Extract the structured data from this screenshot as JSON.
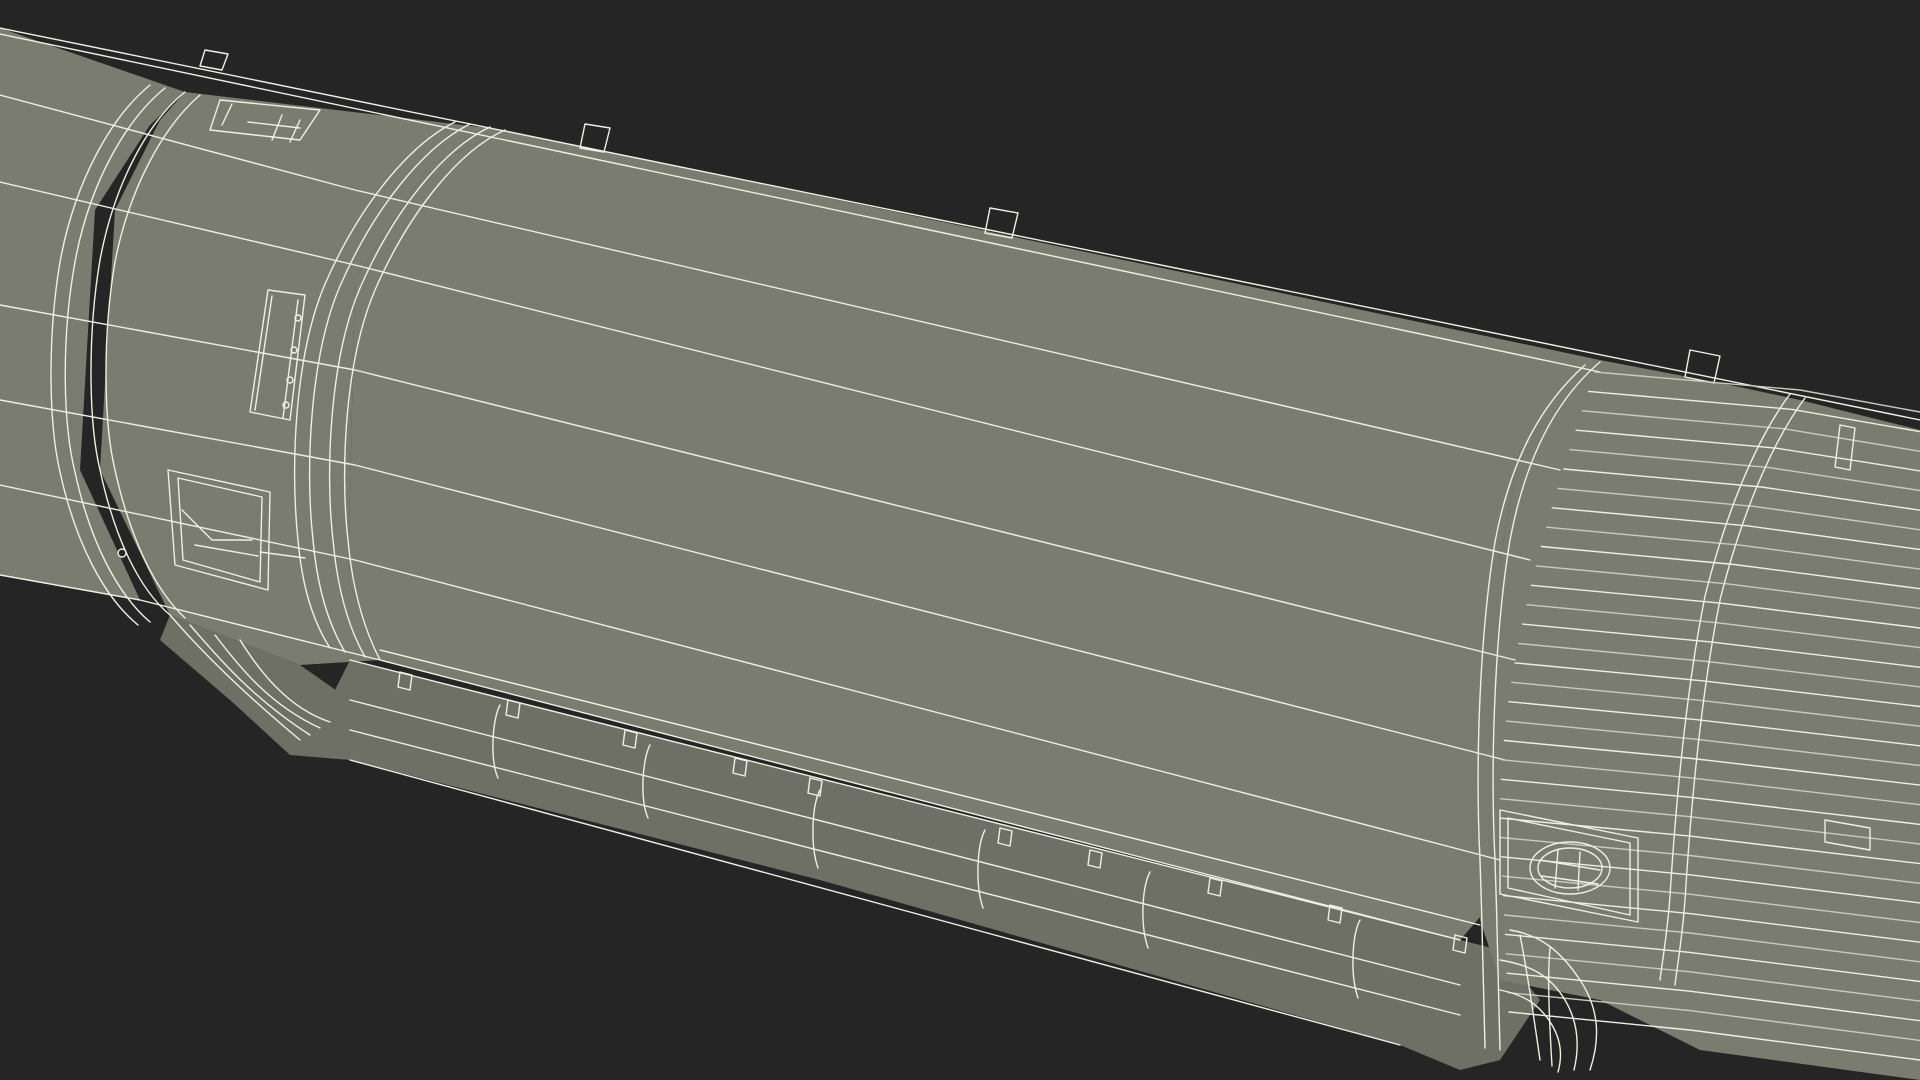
{
  "scene": {
    "background": "#252525",
    "hull_color": "#7b7c70",
    "hull_shadow_color": "#6f7065",
    "wire_color": "#eef0e4",
    "wire_dim_color": "#c9cbbd",
    "gap_color": "#1e1e1e",
    "components": [
      "forward-cylinder",
      "ring-frame-band",
      "hatch-panel",
      "handle-rail",
      "vent-grille",
      "main-tank-section",
      "cable-tunnel",
      "ribbed-skirt",
      "aft-cylinder",
      "porthole",
      "feed-line-elbow"
    ]
  }
}
